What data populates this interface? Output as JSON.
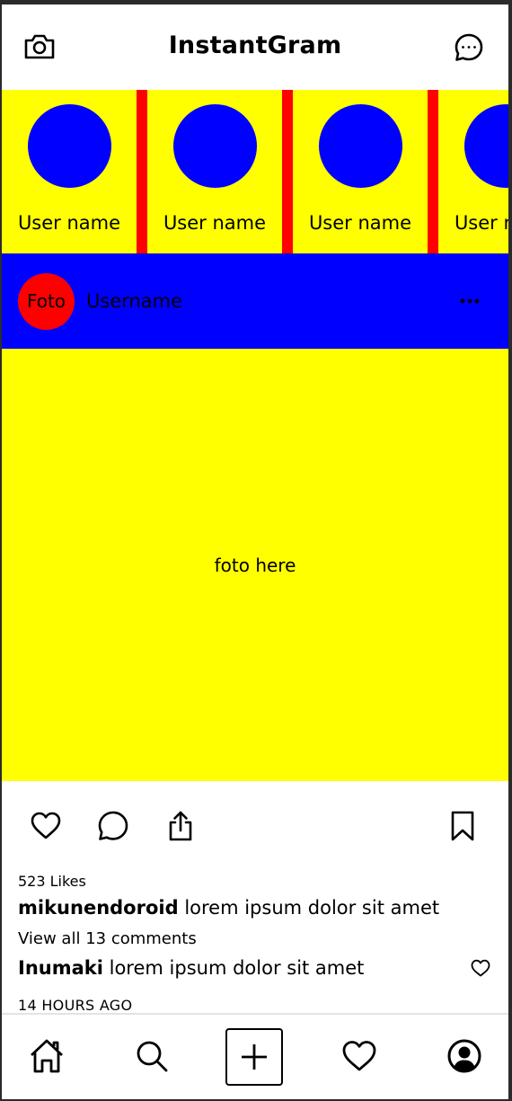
{
  "header": {
    "title": "InstantGram",
    "camera_icon": "camera-icon",
    "messages_icon": "message-bubble-icon"
  },
  "stories": [
    {
      "name": "User name"
    },
    {
      "name": "User name"
    },
    {
      "name": "User name"
    },
    {
      "name": "User name"
    }
  ],
  "post": {
    "avatar_text": "Foto",
    "username": "Username",
    "more_icon": "more-horizontal-icon",
    "photo_text": "foto here",
    "likes": "523 Likes",
    "caption": {
      "user": "mikunendoroid",
      "text": "lorem ipsum dolor sit amet"
    },
    "view_all": "View all 13 comments",
    "comment": {
      "user": "Inumaki",
      "text": "lorem ipsum dolor sit amet"
    },
    "time": "14 HOURS AGO"
  },
  "nav": {
    "home_icon": "home-icon",
    "search_icon": "search-icon",
    "add_icon": "plus-icon",
    "activity_icon": "heart-icon",
    "profile_icon": "profile-icon"
  },
  "colors": {
    "story_bg": "#ffff00",
    "story_avatar": "#0000ff",
    "story_separator": "#ff0000",
    "post_header_bg": "#0000ff",
    "post_avatar": "#ff0000",
    "photo_bg": "#ffff00"
  }
}
